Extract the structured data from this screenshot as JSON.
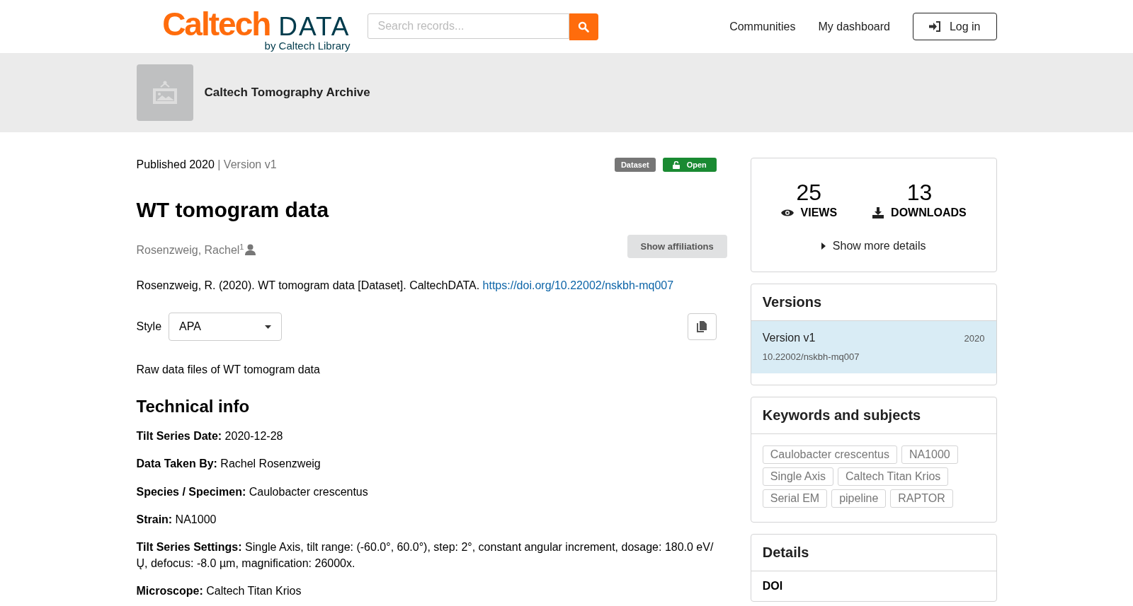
{
  "header": {
    "logo_main": "Caltech",
    "logo_data": "DATA",
    "logo_sub": "by Caltech Library",
    "search": {
      "placeholder": "Search records..."
    },
    "nav": [
      "Communities",
      "My dashboard"
    ],
    "login": "Log in"
  },
  "community": {
    "name": "Caltech Tomography Archive"
  },
  "record": {
    "published": "Published 2020",
    "version": "| Version v1",
    "badges": [
      {
        "label": "Dataset",
        "kind": "type"
      },
      {
        "label": "Open",
        "kind": "access"
      }
    ],
    "title": "WT tomogram data",
    "creator": {
      "name": "Rosenzweig, Rachel",
      "affil": "1"
    },
    "show_affiliations": "Show affiliations",
    "citation": {
      "text": "Rosenzweig, R. (2020). WT tomogram data [Dataset]. CaltechDATA.",
      "link": "https://doi.org/10.22002/nskbh-mq007"
    },
    "style": {
      "label": "Style",
      "value": "APA"
    },
    "description": "Raw data files of WT tomogram data",
    "tech_heading": "Technical info",
    "tech": [
      {
        "label": "Tilt Series Date:",
        "value": "2020-12-28"
      },
      {
        "label": "Data Taken By:",
        "value": "Rachel Rosenzweig"
      },
      {
        "label": "Species / Specimen:",
        "value": "Caulobacter crescentus"
      },
      {
        "label": "Strain:",
        "value": "NA1000"
      },
      {
        "label": "Tilt Series Settings:",
        "value": "Single Axis, tilt range: (-60.0°, 60.0°), step: 2°, constant angular increment, dosage: 180.0 eV/ Ų, defocus: -8.0 µm, magnification: 26000x."
      },
      {
        "label": "Microscope:",
        "value": "Caltech Titan Krios"
      }
    ]
  },
  "stats": {
    "views": "25",
    "views_label": "VIEWS",
    "downloads": "13",
    "downloads_label": "DOWNLOADS",
    "more": "Show more details"
  },
  "versions": {
    "heading": "Versions",
    "items": [
      {
        "title": "Version v1",
        "year": "2020",
        "doi": "10.22002/nskbh-mq007",
        "selected": true
      }
    ]
  },
  "keywords": {
    "heading": "Keywords and subjects",
    "tags": [
      "Caulobacter crescentus",
      "NA1000",
      "Single Axis",
      "Caltech Titan Krios",
      "Serial EM",
      "pipeline",
      "RAPTOR"
    ]
  },
  "details": {
    "heading": "Details",
    "first_label": "DOI"
  }
}
